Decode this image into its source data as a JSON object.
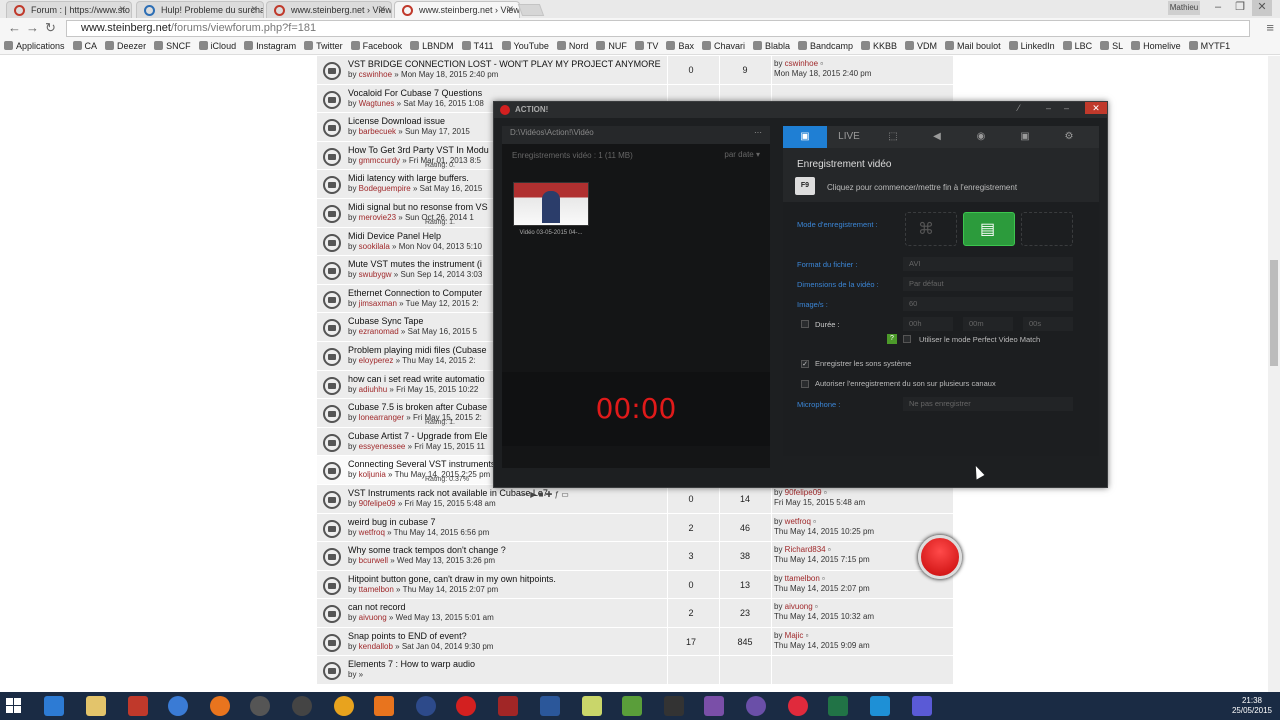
{
  "browser": {
    "tabs": [
      {
        "title": "Forum : | https://www.sto",
        "icon": "red"
      },
      {
        "title": "Hulp! Probleme du surcha",
        "icon": "blue"
      },
      {
        "title": "www.steinberg.net › View",
        "icon": "red"
      },
      {
        "title": "www.steinberg.net › View",
        "icon": "red",
        "active": true
      }
    ],
    "profile": "Mathieu",
    "url_host": "www.steinberg.net",
    "url_path": "/forums/viewforum.php?f=181",
    "bookmarks": [
      "Applications",
      "CA",
      "Deezer",
      "SNCF",
      "iCloud",
      "Instagram",
      "Twitter",
      "Facebook",
      "LBNDM",
      "T411",
      "YouTube",
      "Nord",
      "NUF",
      "TV",
      "Bax",
      "Chavari",
      "Blabla",
      "Bandcamp",
      "KKBB",
      "VDM",
      "Mail boulot",
      "LinkedIn",
      "LBC",
      "SL",
      "Homelive",
      "MYTF1"
    ]
  },
  "forum": {
    "topics": [
      {
        "title": "VST BRIDGE CONNECTION LOST - WON'T PLAY MY PROJECT ANYMORE",
        "user": "cswinhoe",
        "date": "Mon May 18, 2015 2:40 pm",
        "replies": "0",
        "views": "9",
        "last_user": "cswinhoe",
        "last_date": "Mon May 18, 2015 2:40 pm",
        "shade": "g"
      },
      {
        "title": "Vocaloid For Cubase 7 Questions",
        "user": "Wagtunes",
        "date": "Sat May 16, 2015 1:08",
        "replies": "",
        "views": "",
        "last_user": "",
        "last_date": "",
        "shade": "g"
      },
      {
        "title": "License Download issue",
        "user": "barbecuek",
        "date": "Sun May 17, 2015",
        "replies": "",
        "views": "",
        "last_user": "",
        "last_date": "",
        "shade": "g"
      },
      {
        "title": "How To Get 3rd Party VST In Modu",
        "user": "gmmccurdy",
        "date": "Fri Mar 01, 2013 8:5",
        "rating": "Rating: 0.",
        "replies": "",
        "views": "",
        "last_user": "",
        "last_date": "",
        "shade": "g"
      },
      {
        "title": "Midi latency with large buffers.",
        "user": "Bodeguempire",
        "date": "Sat May 16, 2015",
        "replies": "",
        "views": "",
        "last_user": "",
        "last_date": "",
        "shade": "g"
      },
      {
        "title": "Midi signal but no resonse from VS",
        "user": "merovie23",
        "date": "Sun Oct 26, 2014 1",
        "rating": "Rating: 1.",
        "replies": "",
        "views": "",
        "last_user": "",
        "last_date": "",
        "shade": "g"
      },
      {
        "title": "Midi Device Panel Help",
        "user": "sookilala",
        "date": "Mon Nov 04, 2013 5:10",
        "replies": "",
        "views": "",
        "last_user": "",
        "last_date": "",
        "shade": "g"
      },
      {
        "title": "Mute VST mutes the instrument (i",
        "user": "swubygw",
        "date": "Sun Sep 14, 2014 3:03",
        "replies": "",
        "views": "",
        "last_user": "",
        "last_date": "",
        "shade": "g"
      },
      {
        "title": "Ethernet Connection to Computer",
        "user": "jimsaxman",
        "date": "Tue May 12, 2015 2:",
        "replies": "",
        "views": "",
        "last_user": "",
        "last_date": "",
        "shade": "g"
      },
      {
        "title": "Cubase Sync Tape",
        "user": "ezranomad",
        "date": "Sat May 16, 2015 5",
        "replies": "",
        "views": "",
        "last_user": "",
        "last_date": "",
        "shade": "g"
      },
      {
        "title": "Problem playing midi files (Cubase",
        "user": "eloyperez",
        "date": "Thu May 14, 2015 2:",
        "replies": "",
        "views": "",
        "last_user": "",
        "last_date": "",
        "shade": "g"
      },
      {
        "title": "how can i set read write automatio",
        "user": "adiuhhu",
        "date": "Fri May 15, 2015 10:22",
        "replies": "",
        "views": "",
        "last_user": "",
        "last_date": "",
        "shade": "g"
      },
      {
        "title": "Cubase 7.5 is broken after Cubase",
        "user": "lonearranger",
        "date": "Fri May 15, 2015 2:",
        "rating": "Rating: 1.",
        "replies": "",
        "views": "",
        "last_user": "",
        "last_date": "",
        "shade": "g"
      },
      {
        "title": "Cubase Artist 7 - Upgrade from Ele",
        "user": "essyenessee",
        "date": "Fri May 15, 2015 11",
        "replies": "",
        "views": "",
        "last_user": "",
        "last_date": "",
        "shade": "g"
      },
      {
        "title": "Connecting Several VST instruments to one MIDI track",
        "user": "koljunia",
        "date": "Thu May 14, 2015 2:25 pm",
        "rating": "Rating: 0.37%",
        "replies": "2",
        "views": "43",
        "last_user": "koljunia",
        "last_date": "Fri May 15, 2015 3:23 pm",
        "shade": "w"
      },
      {
        "title": "VST Instruments rack not available in Cubase Le7",
        "user": "90felipe09",
        "date": "Fri May 15, 2015 5:48 am",
        "replies": "0",
        "views": "14",
        "last_user": "90felipe09",
        "last_date": "Fri May 15, 2015 5:48 am",
        "shade": "g"
      },
      {
        "title": "weird bug in cubase 7",
        "user": "wetfroq",
        "date": "Thu May 14, 2015 6:56 pm",
        "replies": "2",
        "views": "46",
        "last_user": "wetfroq",
        "last_date": "Thu May 14, 2015 10:25 pm",
        "shade": "g"
      },
      {
        "title": "Why some track tempos don't change ?",
        "user": "bcurwell",
        "date": "Wed May 13, 2015 3:26 pm",
        "replies": "3",
        "views": "38",
        "last_user": "Richard834",
        "last_date": "Thu May 14, 2015 7:15 pm",
        "shade": "g"
      },
      {
        "title": "Hitpoint button gone, can't draw in my own hitpoints.",
        "user": "ttamelbon",
        "date": "Thu May 14, 2015 2:07 pm",
        "replies": "0",
        "views": "13",
        "last_user": "ttamelbon",
        "last_date": "Thu May 14, 2015 2:07 pm",
        "shade": "g"
      },
      {
        "title": "can not record",
        "user": "aivuong",
        "date": "Wed May 13, 2015 5:01 am",
        "replies": "2",
        "views": "23",
        "last_user": "aivuong",
        "last_date": "Thu May 14, 2015 10:32 am",
        "shade": "g"
      },
      {
        "title": "Snap points to END of event?",
        "user": "kendallob",
        "date": "Sat Jan 04, 2014 9:30 pm",
        "replies": "17",
        "views": "845",
        "last_user": "Majic",
        "last_date": "Thu May 14, 2015 9:09 am",
        "shade": "g"
      },
      {
        "title": "Elements 7 : How to warp audio",
        "user": "",
        "date": "",
        "replies": "",
        "views": "",
        "last_user": "",
        "last_date": "",
        "shade": "g"
      }
    ]
  },
  "action": {
    "app_name": "ACTION!",
    "path": "D:\\Vidéos\\Action!\\Vidéo",
    "rec_info": "Enregistrements vidéo : 1 (11 MB)",
    "sort": "par date",
    "thumb_label": "Vidéo 03-05-2015 04-...",
    "timer": "00:00",
    "tabs": [
      "rec",
      "LIVE",
      "crop",
      "sound",
      "webcam",
      "camera",
      "settings"
    ],
    "section_title": "Enregistrement vidéo",
    "hotkey": "F9",
    "click_hint": "Cliquez pour commencer/mettre fin à l'enregistrement",
    "mode_label": "Mode d'enregistrement :",
    "format_label": "Format du fichier :",
    "format_value": "AVI",
    "dims_label": "Dimensions de la vidéo :",
    "dims_value": "Par défaut",
    "fps_label": "Image/s :",
    "fps_value": "60",
    "duration_label": "Durée :",
    "duration_h": "00h",
    "duration_m": "00m",
    "duration_s": "00s",
    "perfect_label": "Utiliser le mode Perfect Video Match",
    "sys_sound_label": "Enregistrer les sons système",
    "multi_label": "Autoriser l'enregistrement du son sur plusieurs canaux",
    "mic_label": "Microphone :",
    "mic_value": "Ne pas enregistrer"
  },
  "taskbar": {
    "time": "21:38",
    "date": "25/05/2015"
  }
}
